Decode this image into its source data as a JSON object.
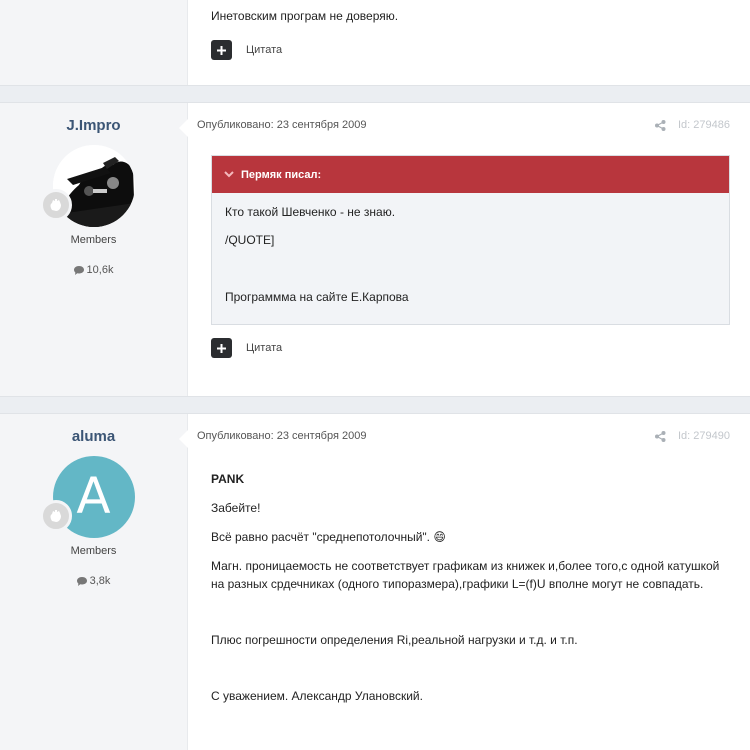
{
  "post_top": {
    "text": "Инетовским програм не доверяю.",
    "quote_label": "Цитата"
  },
  "posts": [
    {
      "author": "J.Impro",
      "group": "Members",
      "post_count": "10,6k",
      "date": "Опубликовано: 23 сентября 2009",
      "id": "Id: 279486",
      "quote": {
        "header": "Пермяк писал:",
        "lines": [
          "Кто такой Шевченко - не знаю.",
          "/QUOTE]",
          "",
          "Программма на сайте Е.Карпова"
        ]
      },
      "quote_label": "Цитата"
    },
    {
      "author": "aluma",
      "avatar_letter": "A",
      "group": "Members",
      "post_count": "3,8k",
      "date": "Опубликовано: 23 сентября 2009",
      "id": "Id: 279490",
      "body": [
        "PANK",
        "Забейте!",
        "Всё равно расчёт \"среднепотолочный\". 😄",
        "Магн. проницаемость не соответствует графикам из книжек и,более того,с одной катушкой на разных срдечниках (одного типоразмера),графики L=(f)U вполне могут не совпадать.",
        "",
        "Плюс погрешности определения Ri,реальной нагрузки и т.д. и т.п.",
        "",
        "С уважением. Александр Улановский."
      ]
    }
  ],
  "colors": {
    "quote_header": "#b8363d",
    "author_name": "#3b5575",
    "avatar_letter_bg": "#63b7c6"
  }
}
